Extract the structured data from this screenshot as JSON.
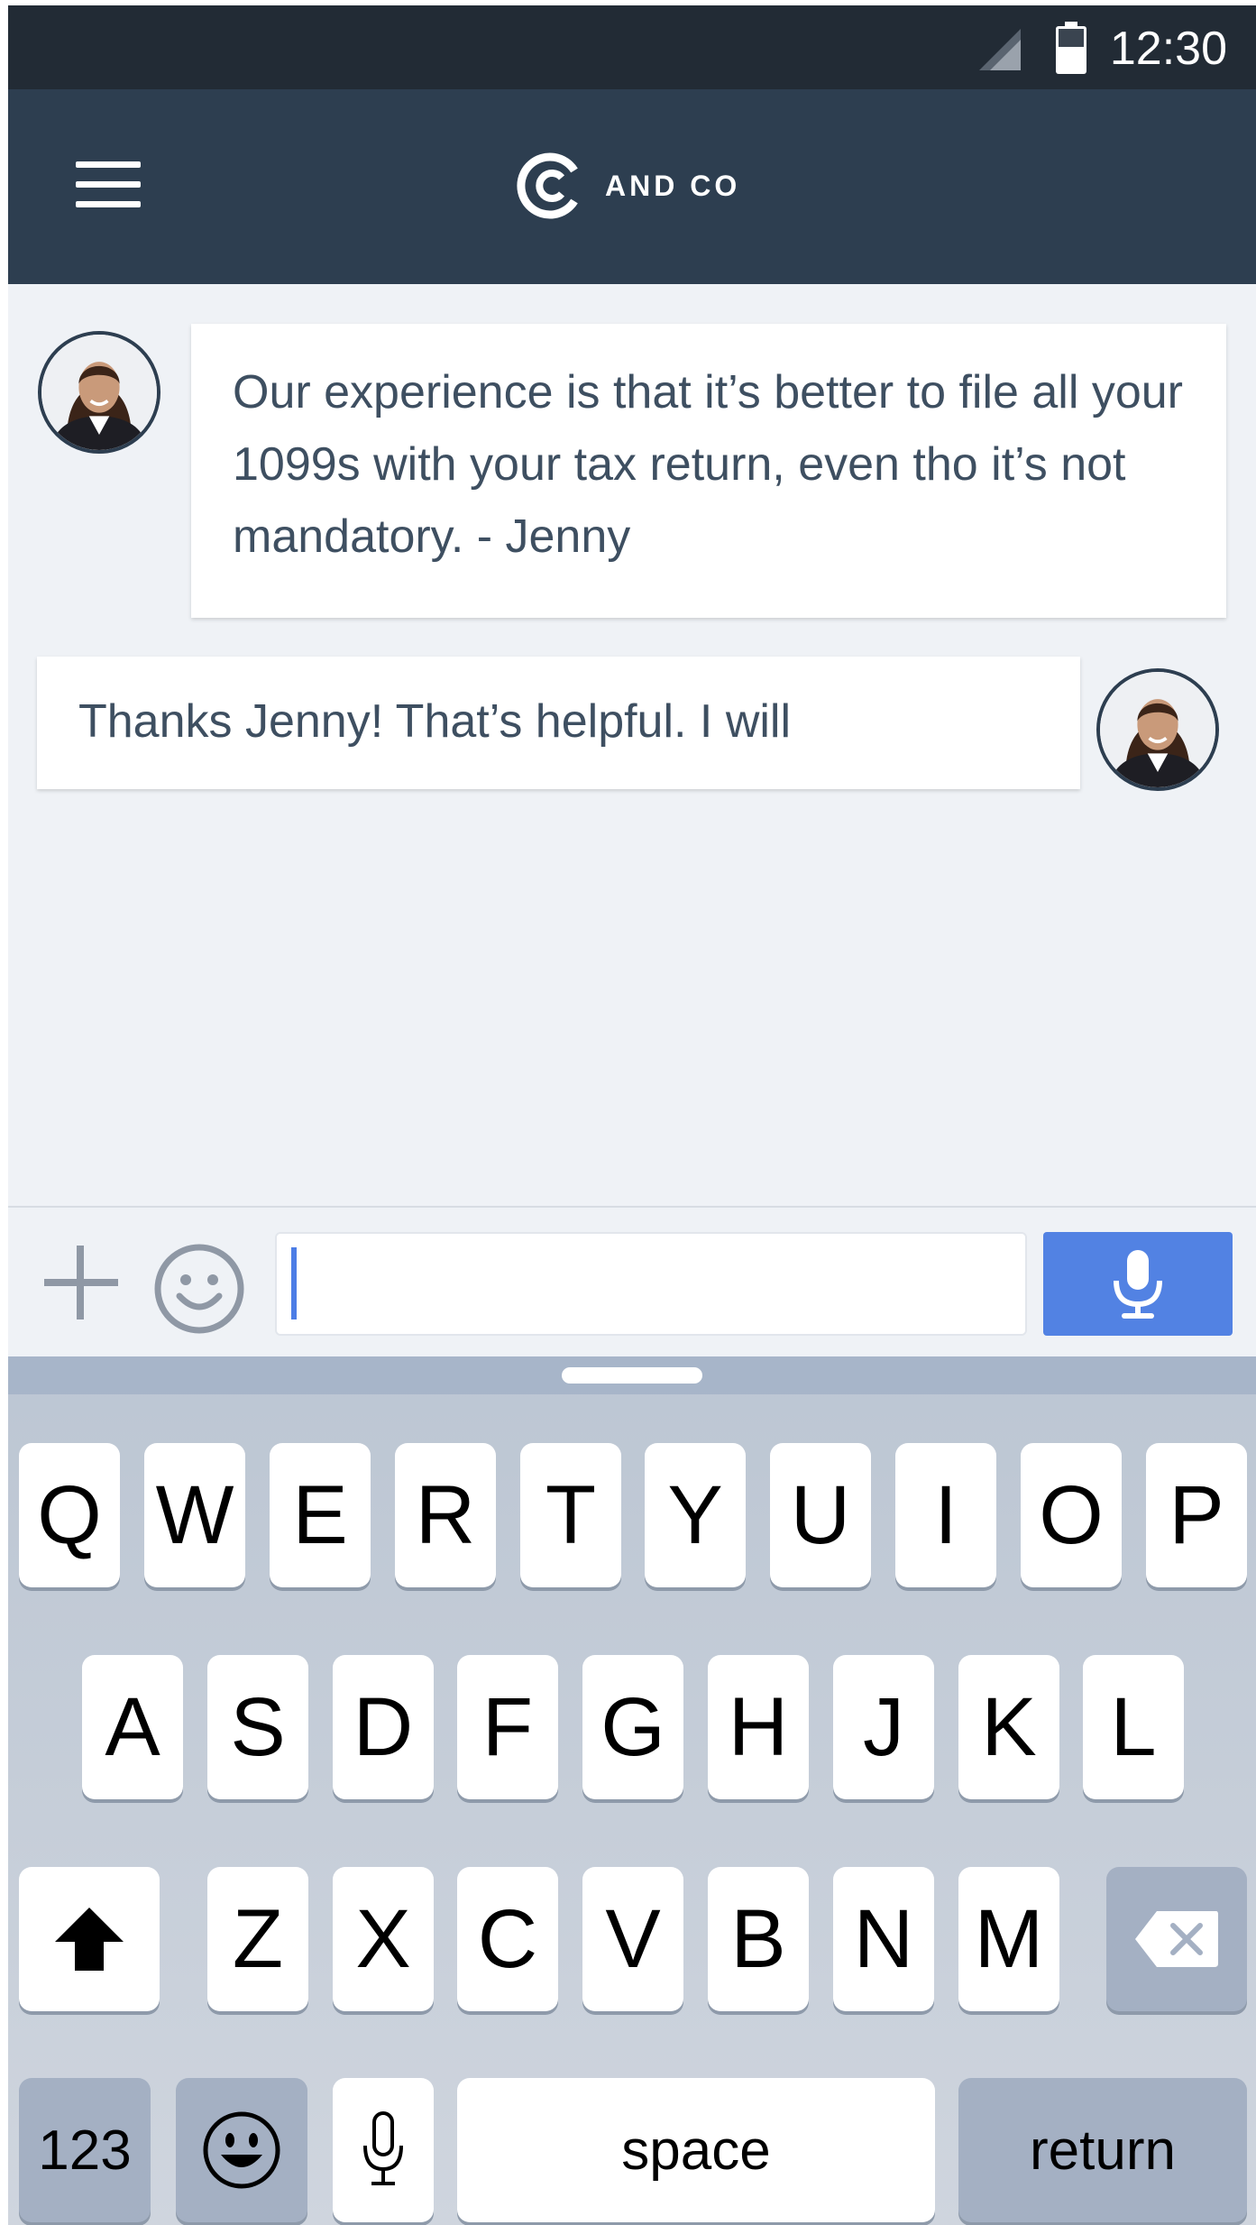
{
  "status_bar": {
    "time": "12:30",
    "icons": [
      "signal-icon",
      "battery-icon"
    ]
  },
  "app_bar": {
    "menu_icon": "menu-icon",
    "brand_text": "AND CO",
    "brand_logo": "and-co-logo"
  },
  "messages": [
    {
      "sender": "agent",
      "text": "Our experience is that it’s better to file all your 1099s with your tax return, even tho it’s not mandatory. - Jenny"
    },
    {
      "sender": "user",
      "text": "Thanks Jenny! That’s helpful. I will"
    }
  ],
  "composer": {
    "value": "",
    "placeholder": "",
    "icons": [
      "plus-icon",
      "smiley-icon",
      "microphone-icon"
    ]
  },
  "keyboard": {
    "row1": [
      "Q",
      "W",
      "E",
      "R",
      "T",
      "Y",
      "U",
      "I",
      "O",
      "P"
    ],
    "row2": [
      "A",
      "S",
      "D",
      "F",
      "G",
      "H",
      "J",
      "K",
      "L"
    ],
    "row3": [
      "Z",
      "X",
      "C",
      "V",
      "B",
      "N",
      "M"
    ],
    "numbers_label": "123",
    "space_label": "space",
    "return_label": "return",
    "icons": [
      "shift-icon",
      "backspace-icon",
      "emoji-keyboard-icon",
      "dictation-icon"
    ]
  },
  "colors": {
    "status_bar": "#222b35",
    "app_bar": "#2d3e50",
    "chat_background": "#eff2f6",
    "message_text": "#3e4f61",
    "mic_button": "#5282e3",
    "caret": "#4c7de6"
  }
}
